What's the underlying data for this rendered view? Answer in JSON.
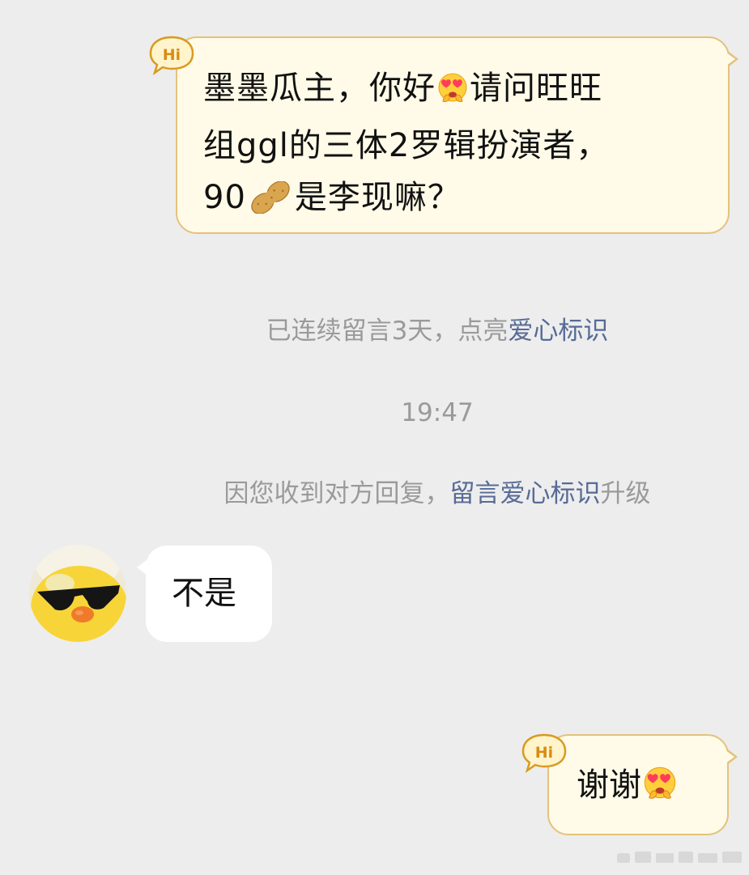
{
  "conversation": {
    "messages": [
      {
        "direction": "outgoing",
        "badge": "Hi",
        "line1_before_emoji": "墨墨瓜主，你好",
        "emoji_1": "heart-eyes-emoji",
        "line1_after_emoji": "请问旺旺",
        "line2": "组ggl的三体2罗辑扮演者，",
        "line3_before_emoji": "90",
        "emoji_2": "peanut-emoji",
        "line3_after_emoji": "是李现嘛？"
      },
      {
        "direction": "incoming",
        "text": "不是",
        "avatar": "duck-with-sunglasses-avatar"
      },
      {
        "direction": "outgoing",
        "badge": "Hi",
        "text": "谢谢",
        "emoji": "heart-eyes-emoji"
      }
    ],
    "system_notices": {
      "streak_prefix": "已连续留言3天，点亮",
      "streak_link": "爱心标识",
      "timestamp": "19:47",
      "upgrade_prefix": "因您收到对方回复，",
      "upgrade_link": "留言爱心标识",
      "upgrade_suffix": "升级"
    }
  },
  "colors": {
    "background": "#ededed",
    "outgoing_bubble": "#fffbe8",
    "outgoing_border": "#e4c27c",
    "incoming_bubble": "#ffffff",
    "system_text": "#9a9a9a",
    "link": "#576b95"
  }
}
